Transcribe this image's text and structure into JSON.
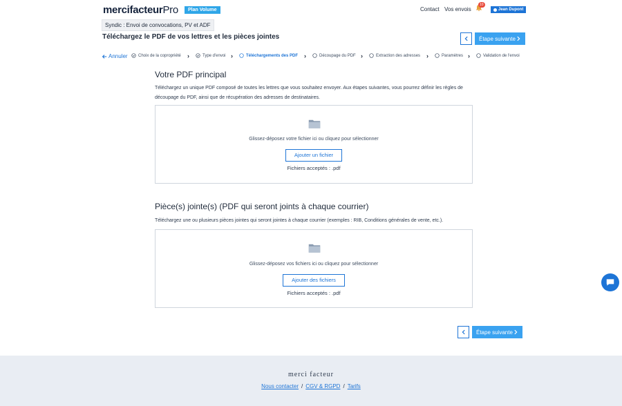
{
  "header": {
    "logo_main": "mercifacteur",
    "logo_suffix": "Pro",
    "plan_badge": "Plan Volume",
    "contact": "Contact",
    "my_mailings": "Vos envois",
    "notification_count": "10",
    "user_name": "Jean Dupont"
  },
  "mode_chip": "Syndic : Envoi de convocations, PV et ADF",
  "page_title": "Téléchargez le PDF de vos lettres et les pièces jointes",
  "nav": {
    "next_label": "Étape suivante",
    "cancel_label": "Annuler"
  },
  "steps": [
    {
      "label": "Choix de la copropriété",
      "state": "done"
    },
    {
      "label": "Type d'envoi",
      "state": "done"
    },
    {
      "label": "Téléchargements des PDF",
      "state": "active"
    },
    {
      "label": "Découpage du PDF",
      "state": "todo"
    },
    {
      "label": "Extraction des adresses",
      "state": "todo"
    },
    {
      "label": "Paramètres",
      "state": "todo"
    },
    {
      "label": "Validation de l'envoi",
      "state": "todo"
    }
  ],
  "main_pdf": {
    "title": "Votre PDF principal",
    "description": "Téléchargez un unique PDF composé de toutes les lettres que vous souhaitez envoyer. Aux étapes suivantes, vous pourrez définir les règles de découpage du PDF, ainsi que de récupération des adresses de destinataires.",
    "drop_text": "Glissez-déposez votre fichier ici ou cliquez pour sélectionner",
    "button": "Ajouter un fichier",
    "accepted": "Fichiers acceptés : .pdf"
  },
  "attachments": {
    "title": "Pièce(s) jointe(s) (PDF qui seront joints à chaque courrier)",
    "description": "Téléchargez une ou plusieurs pièces jointes qui seront jointes à chaque courrier (exemples : RIB, Conditions générales de vente, etc.).",
    "drop_text": "Glissez-déposez vos fichiers ici ou cliquez pour sélectionner",
    "button": "Ajouter des fichiers",
    "accepted": "Fichiers acceptés : .pdf"
  },
  "footer": {
    "logo": "merci facteur",
    "links": [
      "Nous contacter",
      "CGV & RGPD",
      "Tarifs"
    ]
  },
  "colors": {
    "accent": "#1d74d6",
    "next_button": "#3aa2f0",
    "plan_badge": "#2fa6e8",
    "notification": "#e84c3d",
    "footer_bg": "#e9edf3"
  }
}
